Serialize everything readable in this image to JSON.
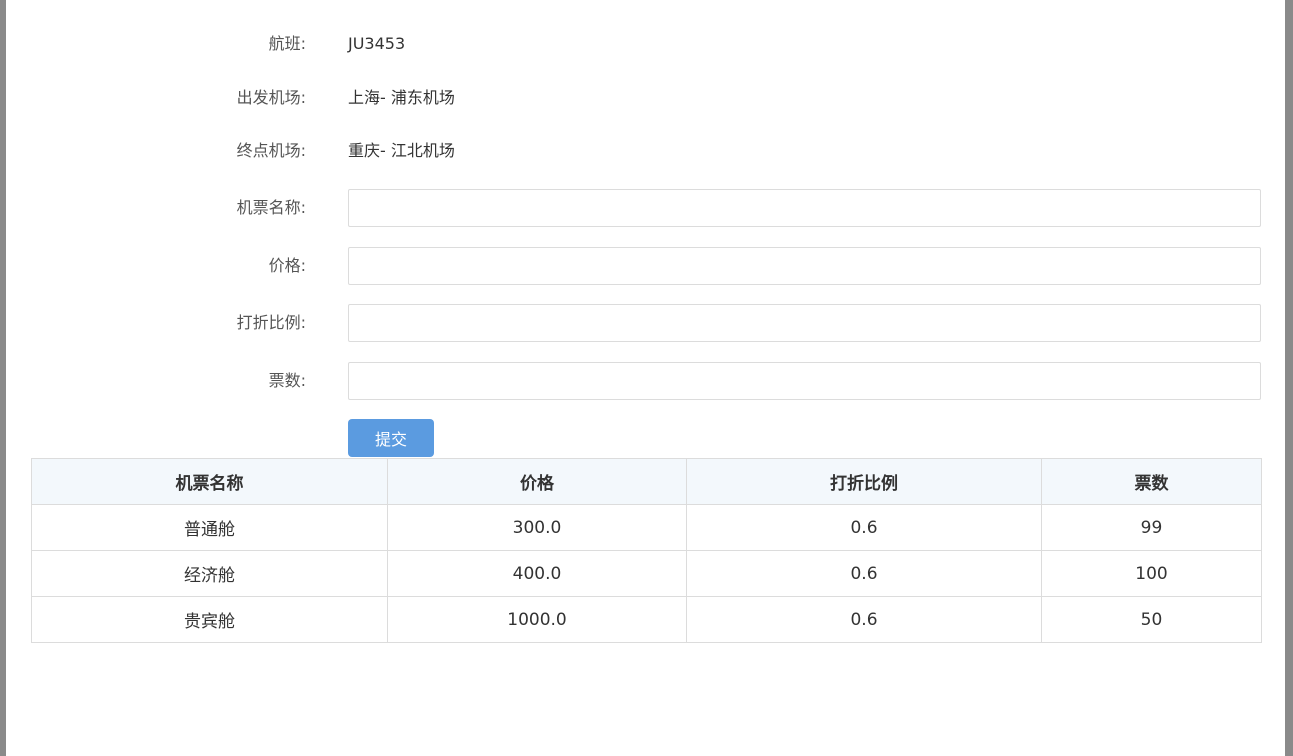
{
  "form": {
    "flight_label": "航班:",
    "flight_value": "JU3453",
    "departure_label": "出发机场:",
    "departure_value": "上海- 浦东机场",
    "destination_label": "终点机场:",
    "destination_value": "重庆- 江北机场",
    "ticket_name_label": "机票名称:",
    "ticket_name_value": "",
    "price_label": "价格:",
    "price_value": "",
    "discount_label": "打折比例:",
    "discount_value": "",
    "count_label": "票数:",
    "count_value": "",
    "submit_label": "提交"
  },
  "table": {
    "headers": [
      "机票名称",
      "价格",
      "打折比例",
      "票数"
    ],
    "rows": [
      [
        "普通舱",
        "300.0",
        "0.6",
        "99"
      ],
      [
        "经济舱",
        "400.0",
        "0.6",
        "100"
      ],
      [
        "贵宾舱",
        "1000.0",
        "0.6",
        "50"
      ]
    ]
  }
}
